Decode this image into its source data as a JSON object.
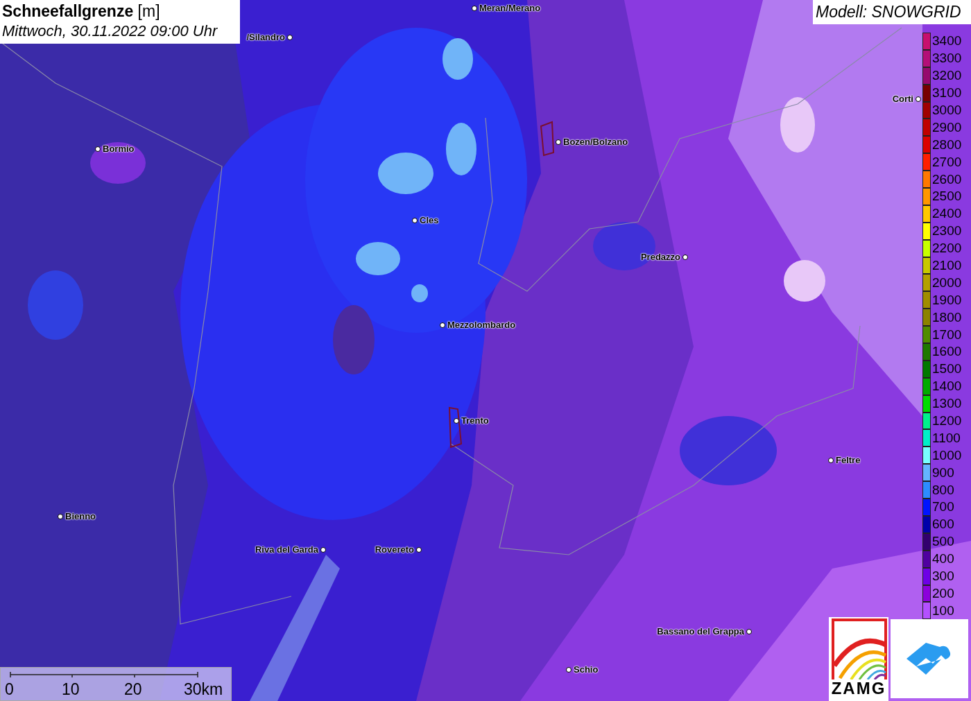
{
  "title": {
    "name": "Schneefallgrenze",
    "unit": "[m]",
    "time": "Mittwoch, 30.11.2022 09:00 Uhr"
  },
  "model": "Modell: SNOWGRID",
  "places": [
    {
      "name": "Meran/Merano"
    },
    {
      "name": "/Silandro"
    },
    {
      "name": "Bormio"
    },
    {
      "name": "Bozen/Bolzano"
    },
    {
      "name": "Corti"
    },
    {
      "name": "Cles"
    },
    {
      "name": "Predazzo"
    },
    {
      "name": "Mezzolombardo"
    },
    {
      "name": "Trento"
    },
    {
      "name": "Feltre"
    },
    {
      "name": "Bienno"
    },
    {
      "name": "Riva del Garda"
    },
    {
      "name": "Rovereto"
    },
    {
      "name": "Bassano del Grappa"
    },
    {
      "name": "Schio"
    }
  ],
  "legend": [
    {
      "label": "3400",
      "color": "#c80f6e"
    },
    {
      "label": "3300",
      "color": "#b40f78"
    },
    {
      "label": "3200",
      "color": "#960a6e"
    },
    {
      "label": "3100",
      "color": "#780000"
    },
    {
      "label": "3000",
      "color": "#a00000"
    },
    {
      "label": "2900",
      "color": "#c00000"
    },
    {
      "label": "2800",
      "color": "#dc0000"
    },
    {
      "label": "2700",
      "color": "#ff1e00"
    },
    {
      "label": "2600",
      "color": "#ff7800"
    },
    {
      "label": "2500",
      "color": "#ff9600"
    },
    {
      "label": "2400",
      "color": "#ffc800"
    },
    {
      "label": "2300",
      "color": "#ffff00"
    },
    {
      "label": "2200",
      "color": "#c8ff00"
    },
    {
      "label": "2100",
      "color": "#c8c800"
    },
    {
      "label": "2000",
      "color": "#b4a000"
    },
    {
      "label": "1900",
      "color": "#a08c00"
    },
    {
      "label": "1800",
      "color": "#8c8200"
    },
    {
      "label": "1700",
      "color": "#508c00"
    },
    {
      "label": "1600",
      "color": "#1e7800"
    },
    {
      "label": "1500",
      "color": "#007800"
    },
    {
      "label": "1400",
      "color": "#00aa00"
    },
    {
      "label": "1300",
      "color": "#00dc00"
    },
    {
      "label": "1200",
      "color": "#00f08c"
    },
    {
      "label": "1100",
      "color": "#00f0c8"
    },
    {
      "label": "1000",
      "color": "#78ffff"
    },
    {
      "label": "900",
      "color": "#64b4ff"
    },
    {
      "label": "800",
      "color": "#2d8cff"
    },
    {
      "label": "700",
      "color": "#0014ff"
    },
    {
      "label": "600",
      "color": "#0000aa"
    },
    {
      "label": "500",
      "color": "#32006e"
    },
    {
      "label": "400",
      "color": "#5000a0"
    },
    {
      "label": "300",
      "color": "#6e00e6"
    },
    {
      "label": "200",
      "color": "#8c00dc"
    },
    {
      "label": "100",
      "color": "#b450ff"
    }
  ],
  "scale": [
    "0",
    "10",
    "20",
    "30km"
  ],
  "logo_text": "ZAMG"
}
